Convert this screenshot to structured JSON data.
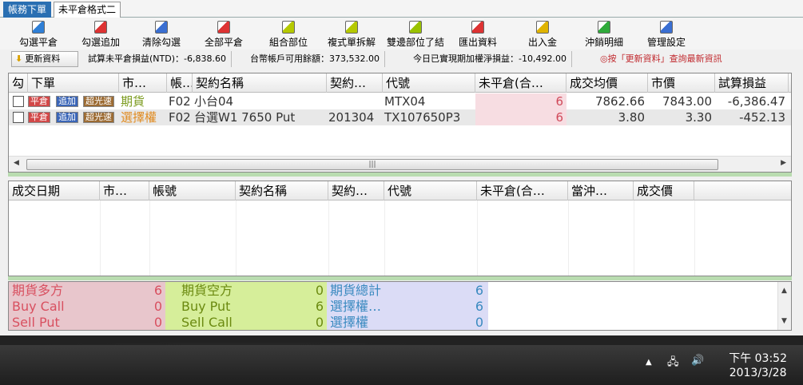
{
  "tabs": [
    {
      "label": "帳務下單",
      "active": true
    },
    {
      "label": "未平倉格式二",
      "active": false
    }
  ],
  "toolbar": [
    {
      "label": "勾選平倉",
      "icon": "check-close-icon",
      "color": "#2f7fd6"
    },
    {
      "label": "勾選追加",
      "icon": "check-add-icon",
      "color": "#d33"
    },
    {
      "label": "清除勾選",
      "icon": "clear-check-icon",
      "color": "#3a6fd2"
    },
    {
      "label": "全部平倉",
      "icon": "close-all-icon",
      "color": "#d33"
    },
    {
      "label": "組合部位",
      "icon": "combine-position-icon",
      "color": "#b5c900"
    },
    {
      "label": "複式單拆解",
      "icon": "split-order-icon",
      "color": "#b5c900"
    },
    {
      "label": "雙邊部位了結",
      "icon": "settle-both-icon",
      "color": "#9ac200"
    },
    {
      "label": "匯出資料",
      "icon": "export-icon",
      "color": "#d33"
    },
    {
      "label": "出入金",
      "icon": "money-icon",
      "color": "#e0b400"
    },
    {
      "label": "沖銷明細",
      "icon": "offset-detail-icon",
      "color": "#2faa3a"
    },
    {
      "label": "管理設定",
      "icon": "settings-icon",
      "color": "#3a6fd2"
    }
  ],
  "info": {
    "refresh_label": "更新資料",
    "unrealized": "試算未平倉損益(NTD)：-6,838.60",
    "available": "台幣帳戶可用餘額：373,532.00",
    "realized": "今日已實現期加權淨損益：-10,492.00",
    "hint": "◎按「更新資料」查詢最新資訊",
    "hint_color": "#c0282d"
  },
  "positions": {
    "headers": [
      "勾",
      "下單",
      "市…",
      "帳…",
      "契約名稱",
      "契約…",
      "代號",
      "未平倉(合…",
      "成交均價",
      "市價",
      "試算損益"
    ],
    "buttons": {
      "close": "平倉",
      "add": "追加",
      "flash": "超光速"
    },
    "rows": [
      {
        "market": "期貨",
        "market_color": "#7a9a1c",
        "account": "F02",
        "contract": "小台04",
        "month": "",
        "code": "MTX04",
        "open": "6",
        "avg": "7862.66",
        "price": "7843.00",
        "pnl": "-6,386.47"
      },
      {
        "market": "選擇權",
        "market_color": "#e08a1f",
        "account": "F02",
        "contract": "台選W1 7650 Put",
        "month": "201304",
        "code": "TX107650P3",
        "open": "6",
        "avg": "3.80",
        "price": "3.30",
        "pnl": "-452.13"
      }
    ]
  },
  "trades": {
    "headers": [
      "成交日期",
      "市…",
      "帳號",
      "契約名稱",
      "契約…",
      "代號",
      "未平倉(合…",
      "當沖…",
      "成交價"
    ]
  },
  "summary": {
    "rows": [
      [
        {
          "label": "期貨多方",
          "value": "6"
        },
        {
          "label": "期貨空方",
          "value": "0"
        },
        {
          "label": "期貨總計",
          "value": "6"
        }
      ],
      [
        {
          "label": "Buy Call",
          "value": "0"
        },
        {
          "label": "Buy Put",
          "value": "6"
        },
        {
          "label": "選擇權…",
          "value": "6"
        }
      ],
      [
        {
          "label": "Sell Put",
          "value": "0"
        },
        {
          "label": "Sell Call",
          "value": "0"
        },
        {
          "label": "選擇權",
          "value": "0"
        }
      ]
    ],
    "colors": {
      "red": "#e8c6cc",
      "green": "#d6ee9a",
      "blue": "#dbdcf6"
    }
  },
  "taskbar": {
    "time": "下午 03:52",
    "date": "2013/3/28"
  }
}
